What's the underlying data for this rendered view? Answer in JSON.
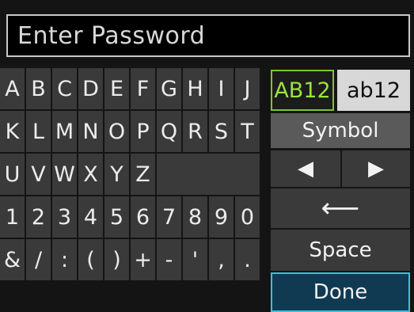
{
  "title": {
    "placeholder_text": "Enter Password"
  },
  "keyboard": {
    "rows": [
      [
        "A",
        "B",
        "C",
        "D",
        "E",
        "F",
        "G",
        "H",
        "I",
        "J"
      ],
      [
        "K",
        "L",
        "M",
        "N",
        "O",
        "P",
        "Q",
        "R",
        "S",
        "T"
      ],
      [
        "U",
        "V",
        "W",
        "X",
        "Y",
        "Z"
      ],
      [
        "1",
        "2",
        "3",
        "4",
        "5",
        "6",
        "7",
        "8",
        "9",
        "0"
      ],
      [
        "&",
        "/",
        ":",
        "(",
        ")",
        "+",
        "-",
        "'",
        ",",
        "."
      ]
    ]
  },
  "controls": {
    "mode_upper": "AB12",
    "mode_lower": "ab12",
    "symbol": "Symbol",
    "left_arrow": "◀",
    "right_arrow": "▶",
    "backspace": "⟵",
    "space": "Space",
    "done": "Done"
  },
  "colors": {
    "selected_mode_text": "#9be33c",
    "done_border": "#36c3e0",
    "background": "#141414"
  },
  "icons": [
    "left-arrow-icon",
    "right-arrow-icon",
    "backspace-icon"
  ]
}
